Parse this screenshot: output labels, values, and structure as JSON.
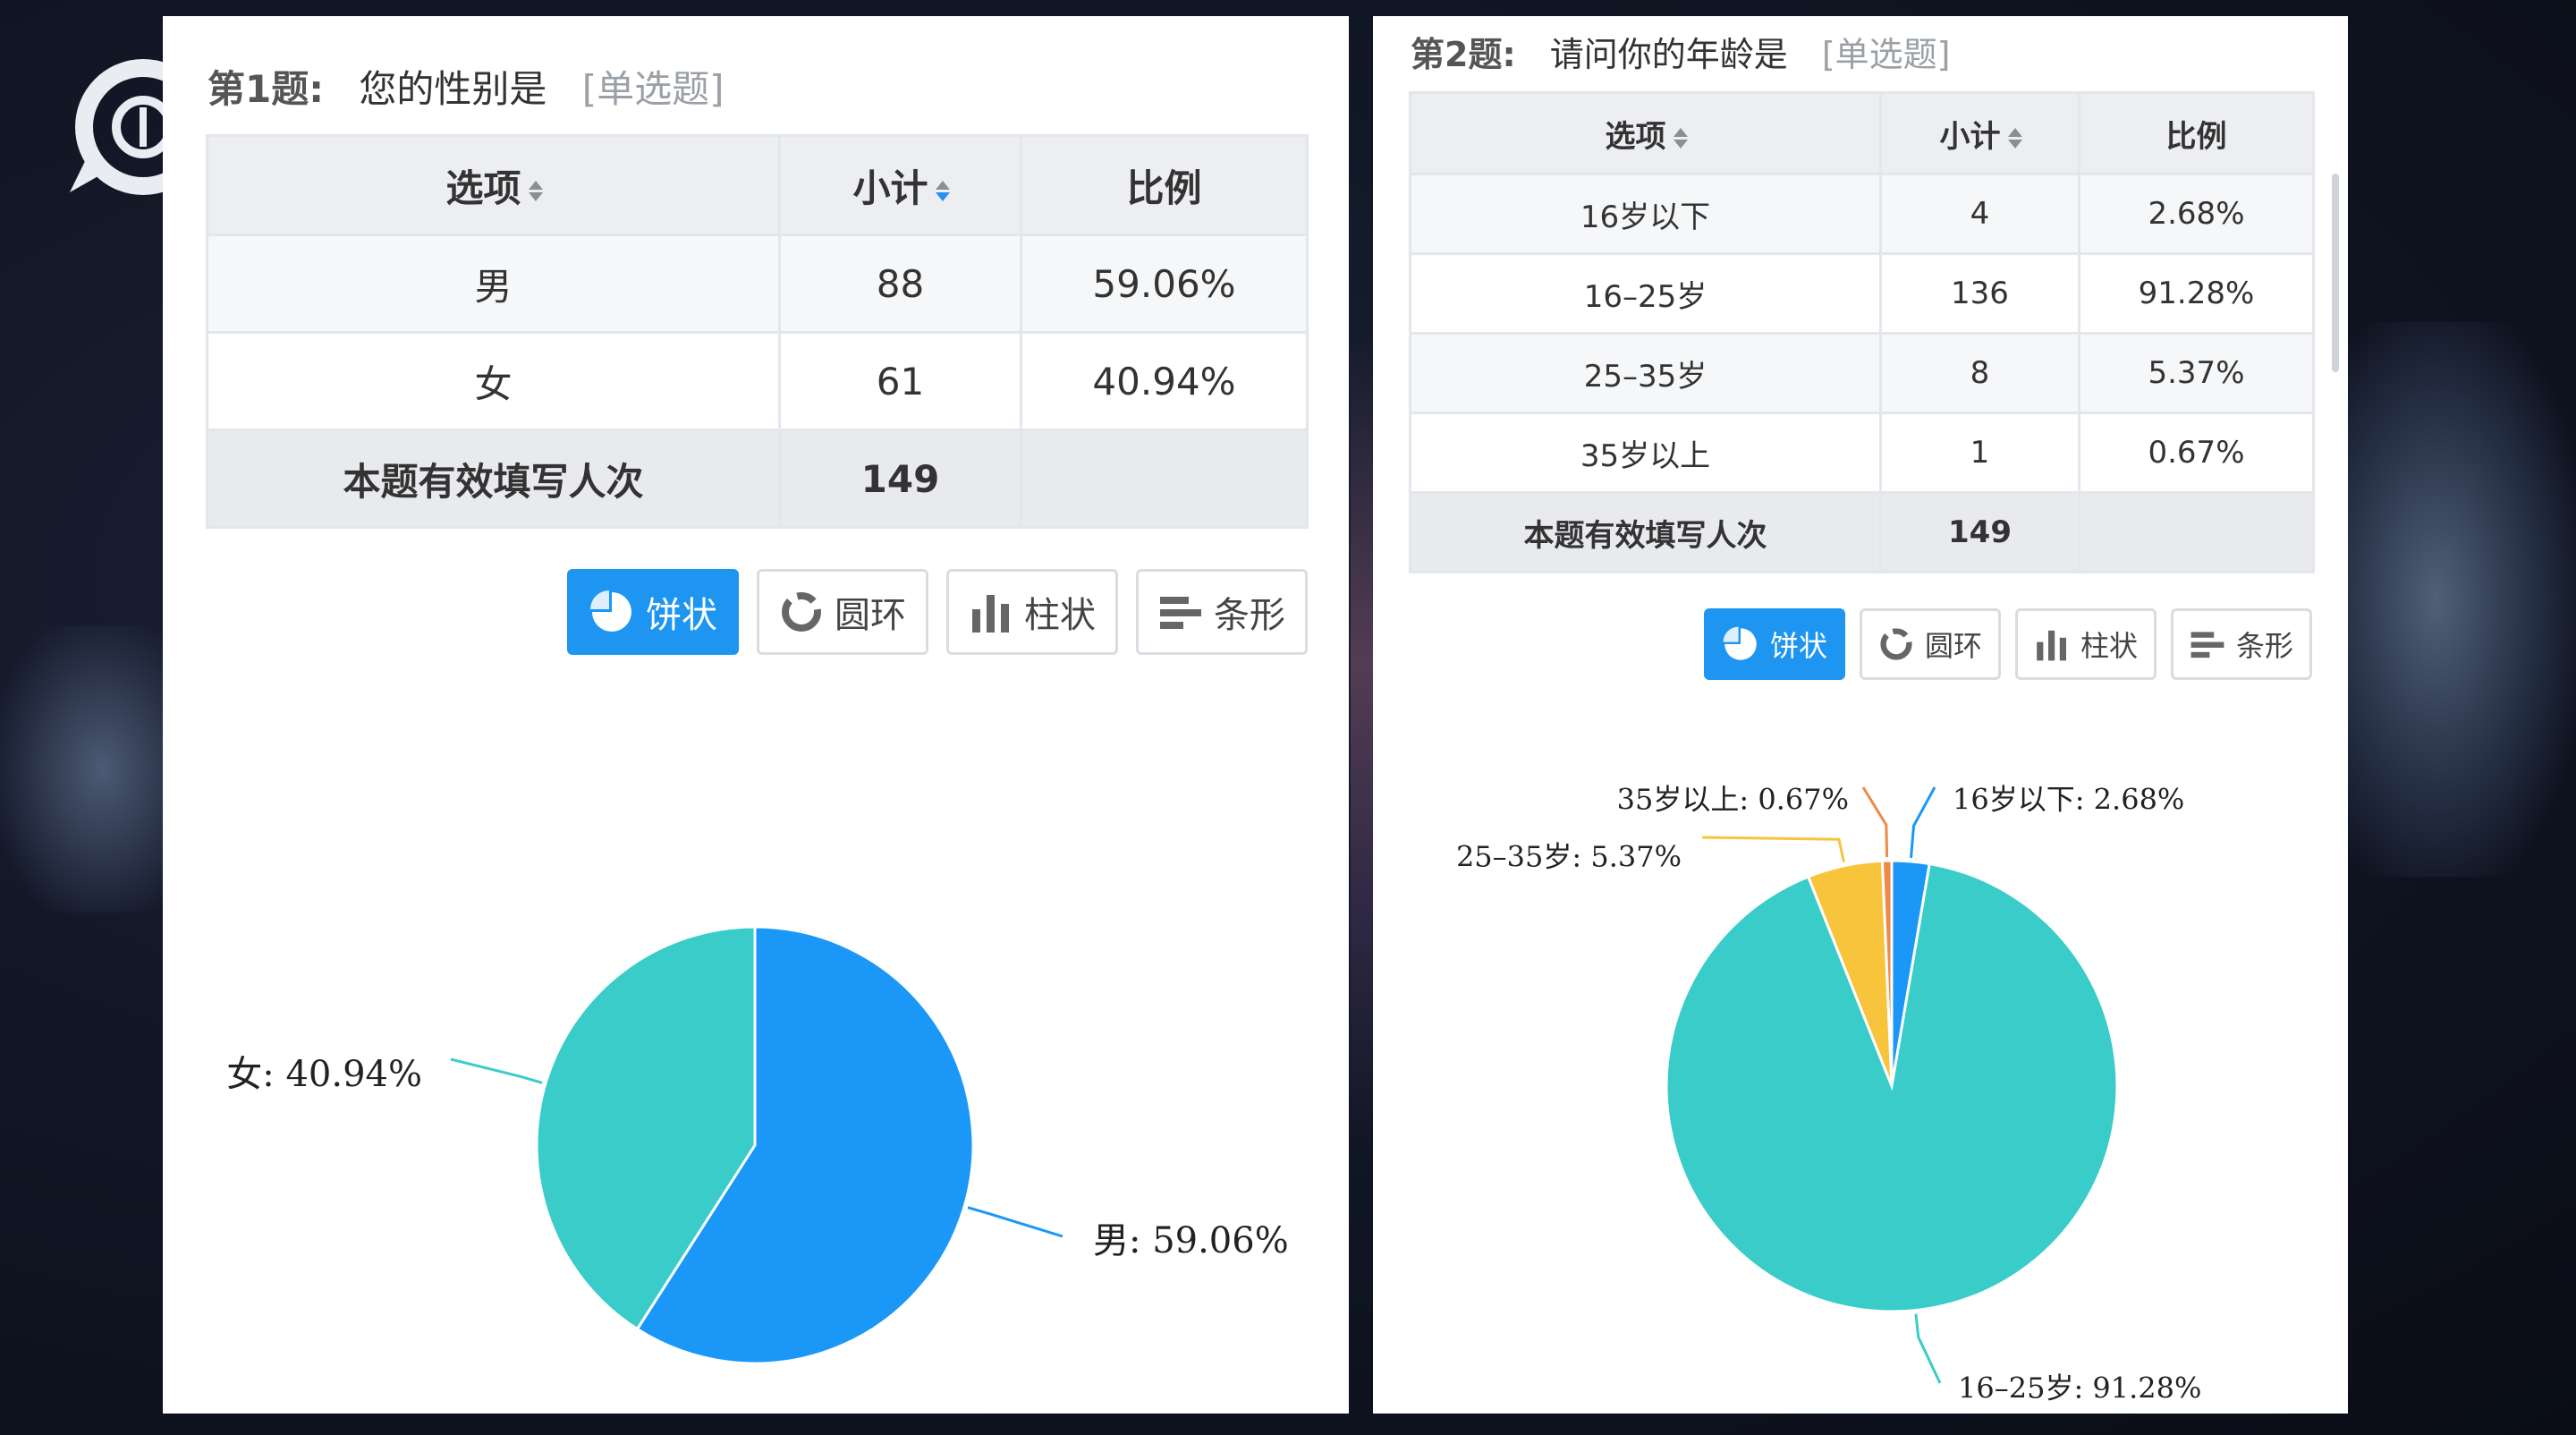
{
  "q1": {
    "number": "第1题:",
    "text": "您的性别是",
    "type": "[单选题]",
    "headers": {
      "option": "选项",
      "count": "小计",
      "ratio": "比例"
    },
    "rows": [
      {
        "option": "男",
        "count": "88",
        "ratio": "59.06%"
      },
      {
        "option": "女",
        "count": "61",
        "ratio": "40.94%"
      }
    ],
    "total": {
      "label": "本题有效填写人次",
      "count": "149"
    },
    "buttons": {
      "pie": "饼状",
      "donut": "圆环",
      "column": "柱状",
      "bar": "条形"
    }
  },
  "q2": {
    "number": "第2题:",
    "text": "请问你的年龄是",
    "type": "[单选题]",
    "headers": {
      "option": "选项",
      "count": "小计",
      "ratio": "比例"
    },
    "rows": [
      {
        "option": "16岁以下",
        "count": "4",
        "ratio": "2.68%"
      },
      {
        "option": "16–25岁",
        "count": "136",
        "ratio": "91.28%"
      },
      {
        "option": "25–35岁",
        "count": "8",
        "ratio": "5.37%"
      },
      {
        "option": "35岁以上",
        "count": "1",
        "ratio": "0.67%"
      }
    ],
    "total": {
      "label": "本题有效填写人次",
      "count": "149"
    },
    "buttons": {
      "pie": "饼状",
      "donut": "圆环",
      "column": "柱状",
      "bar": "条形"
    }
  },
  "chart_data": [
    {
      "type": "pie",
      "categories": [
        "男",
        "女"
      ],
      "values": [
        59.06,
        40.94
      ],
      "labels": [
        "男: 59.06%",
        "女: 40.94%"
      ],
      "colors": [
        "#1a97f7",
        "#39ccc9"
      ]
    },
    {
      "type": "pie",
      "categories": [
        "16岁以下",
        "16–25岁",
        "25–35岁",
        "35岁以上"
      ],
      "values": [
        2.68,
        91.28,
        5.37,
        0.67
      ],
      "labels": [
        "16岁以下: 2.68%",
        "16–25岁: 91.28%",
        "25–35岁: 5.37%",
        "35岁以上: 0.67%"
      ],
      "colors": [
        "#1a97f7",
        "#39ccc9",
        "#f8c43c",
        "#ee8a47"
      ]
    }
  ]
}
